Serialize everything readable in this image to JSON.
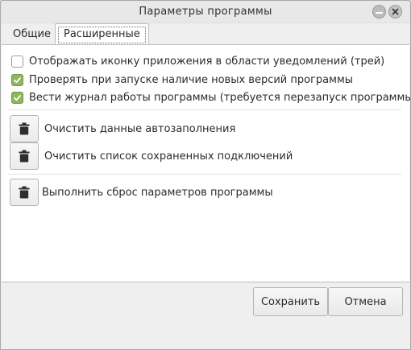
{
  "window": {
    "title": "Параметры программы"
  },
  "titlebar": {
    "minimize_icon": "minimize-icon",
    "close_icon": "close-icon"
  },
  "tabs": [
    {
      "label": "Общие",
      "active": false
    },
    {
      "label": "Расширенные",
      "active": true
    }
  ],
  "options": [
    {
      "label": "Отображать иконку приложения в области уведомлений (трей)",
      "checked": false
    },
    {
      "label": "Проверять при запуске наличие новых версий программы",
      "checked": true
    },
    {
      "label": "Вести журнал работы программы (требуется перезапуск программы)",
      "checked": true
    }
  ],
  "actions": [
    {
      "label": "Очистить данные автозаполнения",
      "icon": "trash-icon"
    },
    {
      "label": "Очистить список сохраненных подключений",
      "icon": "trash-icon"
    },
    {
      "label": "Выполнить сброс параметров программы",
      "icon": "trash-icon"
    }
  ],
  "buttons": {
    "save": "Сохранить",
    "cancel": "Отмена"
  },
  "colors": {
    "checkbox_checked": "#8fb561",
    "window_bg": "#efefef",
    "panel_bg": "#ffffff"
  }
}
